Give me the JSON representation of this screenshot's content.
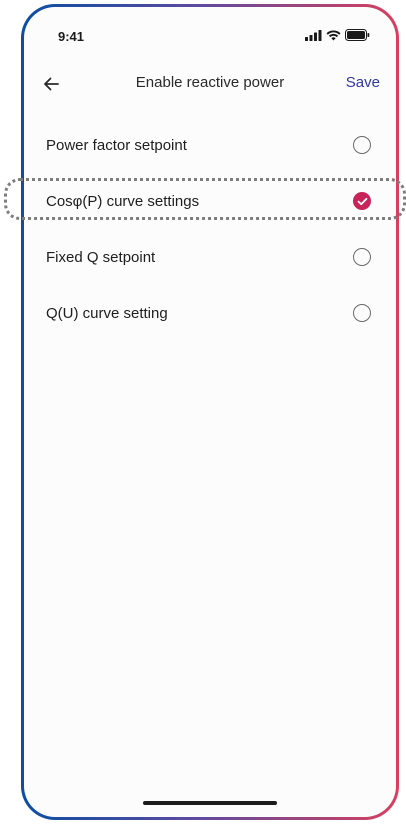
{
  "status_bar": {
    "time": "9:41",
    "icons": [
      "signal-icon",
      "wifi-icon",
      "battery-icon"
    ]
  },
  "header": {
    "back_icon": "arrow-left-icon",
    "title": "Enable reactive power",
    "save_label": "Save"
  },
  "options": [
    {
      "label": "Power factor setpoint",
      "selected": false
    },
    {
      "label": "Cosφ(P) curve settings",
      "selected": true
    },
    {
      "label": "Fixed Q setpoint",
      "selected": false
    },
    {
      "label": "Q(U) curve setting",
      "selected": false
    }
  ],
  "colors": {
    "accent": "#c8245a",
    "link": "#2f3aa1",
    "frame_left": "#0a4ea3",
    "frame_right": "#d7405e"
  }
}
